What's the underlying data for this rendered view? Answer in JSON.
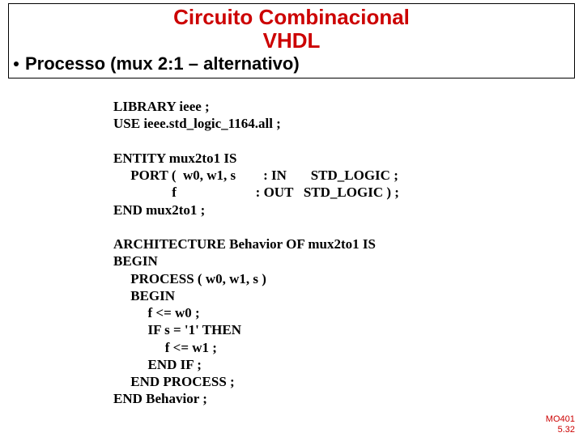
{
  "header": {
    "title_line1": "Circuito Combinacional",
    "title_line2": "VHDL",
    "title_color": "#cc0000",
    "subtitle": "Processo (mux 2:1 – alternativo)"
  },
  "code": {
    "line01": "LIBRARY ieee ;",
    "line02": "USE ieee.std_logic_1164.all ;",
    "line03": "",
    "line04": "ENTITY mux2to1 IS",
    "line05": "     PORT (  w0, w1, s        : IN       STD_LOGIC ;",
    "line06": "                 f                       : OUT   STD_LOGIC ) ;",
    "line07": "END mux2to1 ;",
    "line08": "",
    "line09": "ARCHITECTURE Behavior OF mux2to1 IS",
    "line10": "BEGIN",
    "line11": "     PROCESS ( w0, w1, s )",
    "line12": "     BEGIN",
    "line13": "          f <= w0 ;",
    "line14": "          IF s = '1' THEN",
    "line15": "               f <= w1 ;",
    "line16": "          END IF ;",
    "line17": "     END PROCESS ;",
    "line18": "END Behavior ;"
  },
  "footer": {
    "course": "MO401",
    "page": "5.32",
    "color": "#cc0000"
  }
}
